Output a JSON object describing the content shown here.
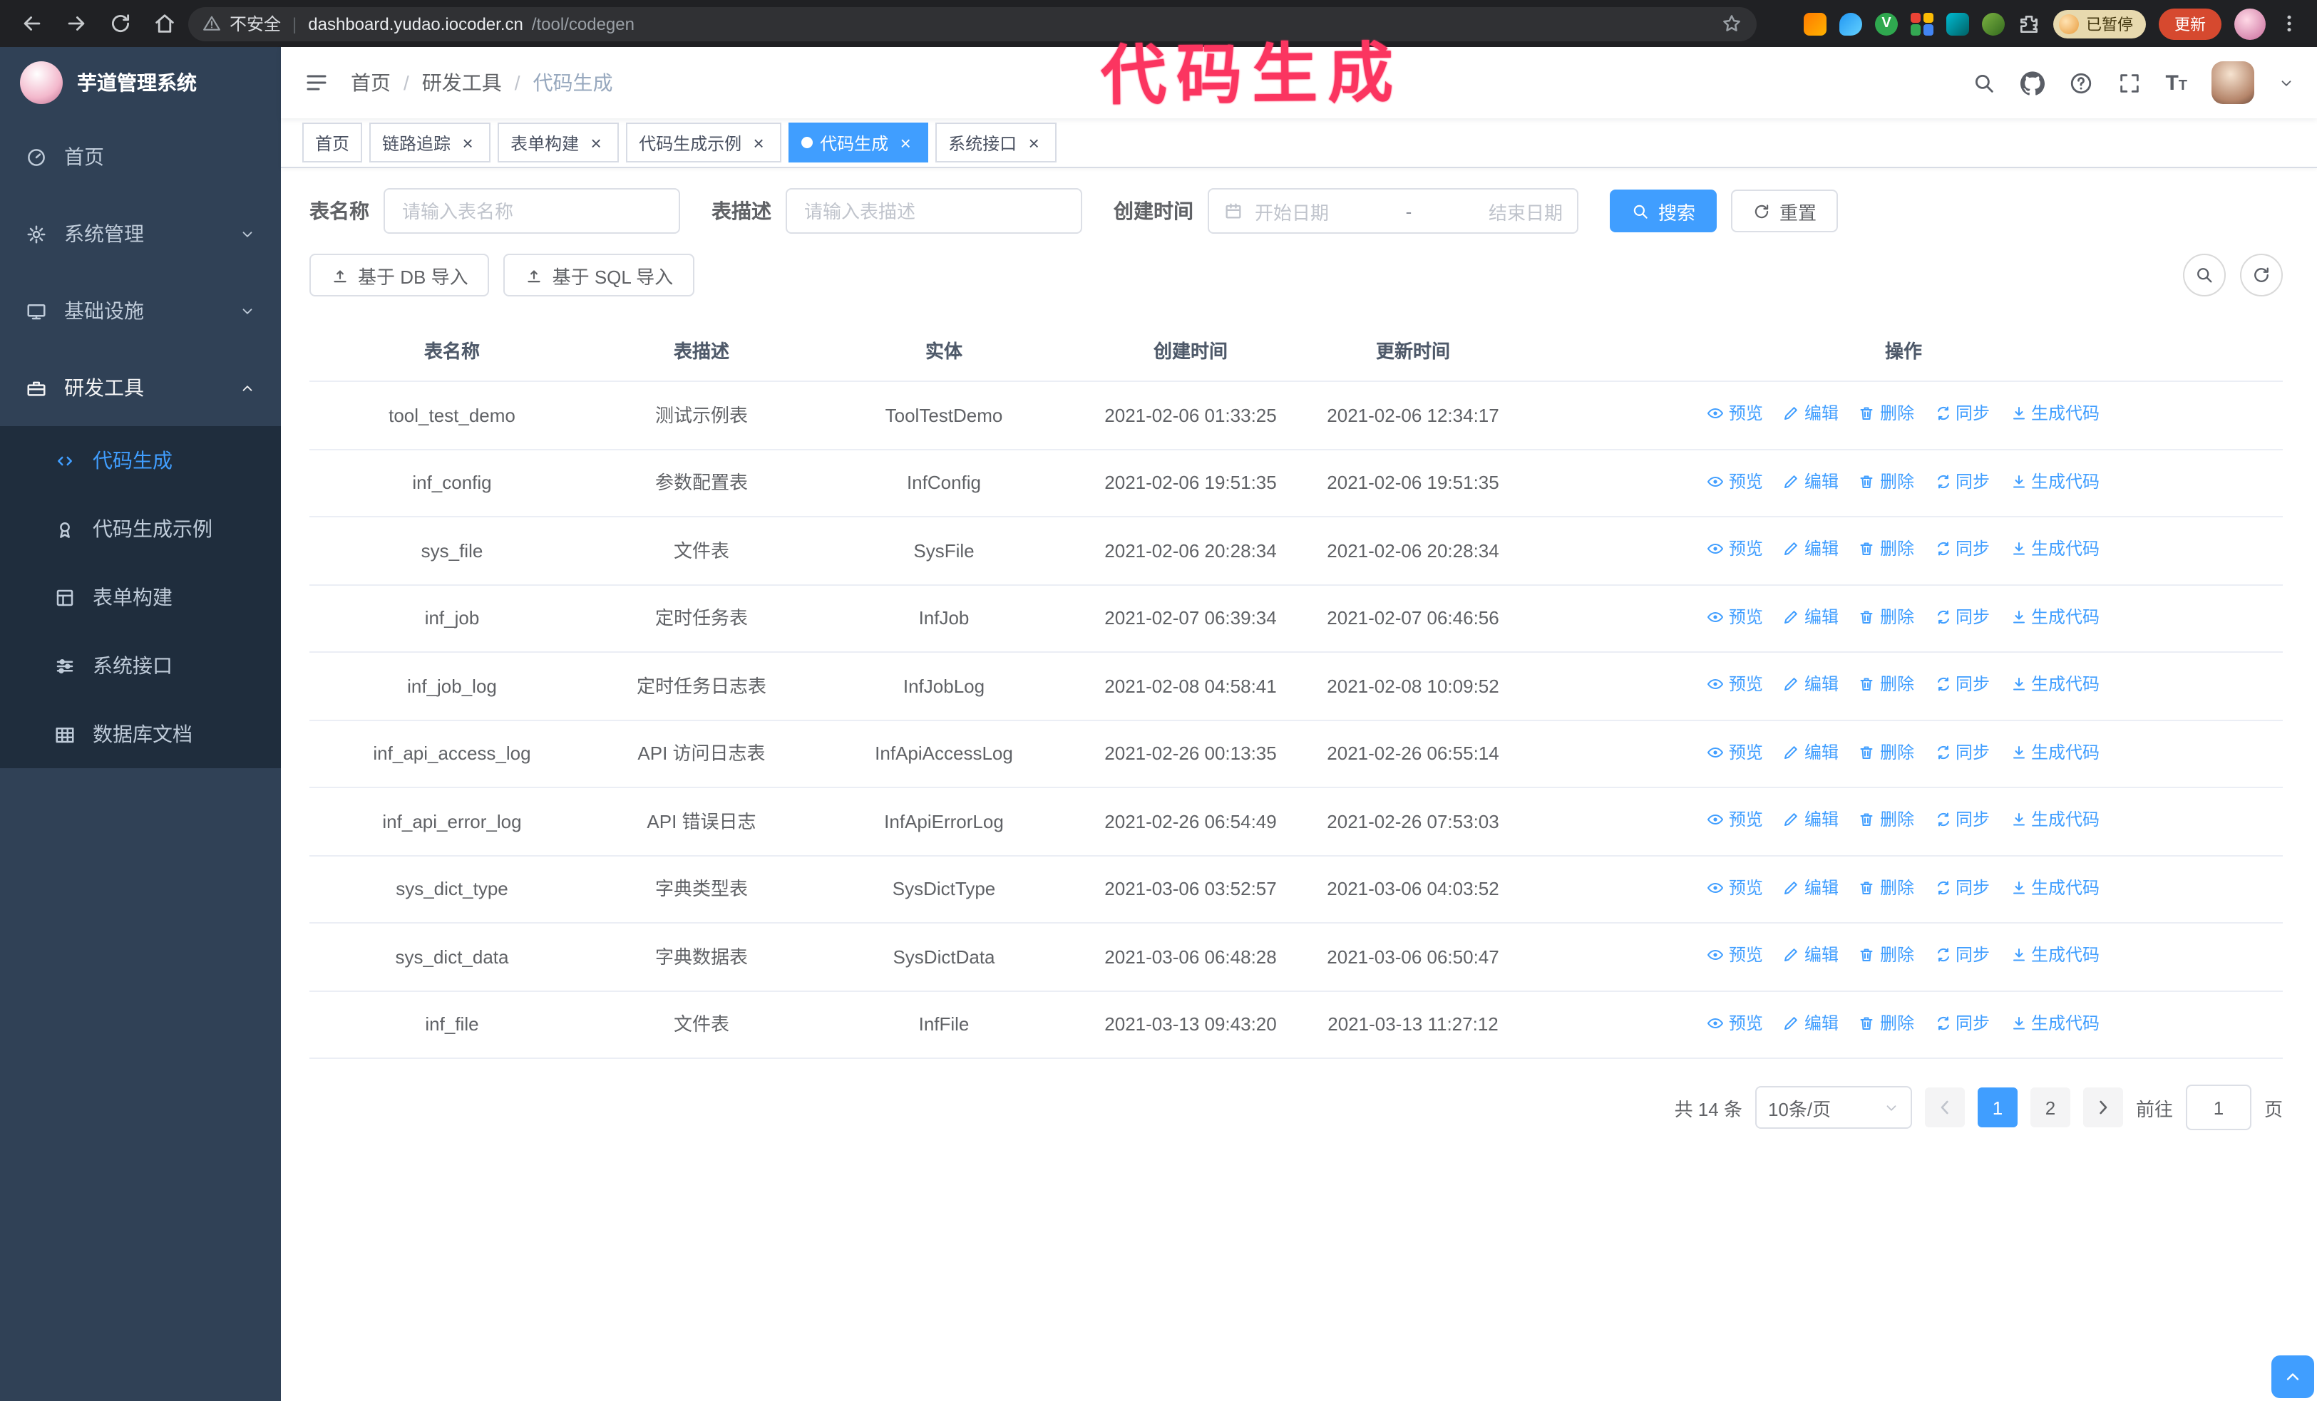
{
  "browser": {
    "security_label": "不安全",
    "url_domain": "dashboard.yudao.iocoder.cn",
    "url_path": "/tool/codegen",
    "separator": "|",
    "paused_badge": "已暂停",
    "update_button": "更新"
  },
  "annotation": {
    "text": "代码生成",
    "color": "#fb3560"
  },
  "sidebar": {
    "logo_title": "芋道管理系统",
    "menu": [
      {
        "label": "首页",
        "icon": "gauge-icon"
      },
      {
        "label": "系统管理",
        "icon": "gear-icon",
        "expandable": true
      },
      {
        "label": "基础设施",
        "icon": "infra-icon",
        "expandable": true
      },
      {
        "label": "研发工具",
        "icon": "tools-icon",
        "expandable": true,
        "expanded": true,
        "children": [
          {
            "label": "代码生成",
            "icon": "code-icon",
            "active": true
          },
          {
            "label": "代码生成示例",
            "icon": "medal-icon"
          },
          {
            "label": "表单构建",
            "icon": "form-icon"
          },
          {
            "label": "系统接口",
            "icon": "api-icon"
          },
          {
            "label": "数据库文档",
            "icon": "dbdoc-icon"
          }
        ]
      }
    ]
  },
  "header": {
    "breadcrumb": [
      {
        "label": "首页"
      },
      {
        "label": "研发工具"
      },
      {
        "label": "代码生成"
      }
    ],
    "separator": "/"
  },
  "tabs": [
    {
      "label": "首页",
      "closable": false,
      "active": false
    },
    {
      "label": "链路追踪",
      "closable": true,
      "active": false
    },
    {
      "label": "表单构建",
      "closable": true,
      "active": false
    },
    {
      "label": "代码生成示例",
      "closable": true,
      "active": false
    },
    {
      "label": "代码生成",
      "closable": true,
      "active": true
    },
    {
      "label": "系统接口",
      "closable": true,
      "active": false
    }
  ],
  "filters": {
    "table_name_label": "表名称",
    "table_name_placeholder": "请输入表名称",
    "table_desc_label": "表描述",
    "table_desc_placeholder": "请输入表描述",
    "create_time_label": "创建时间",
    "start_date_placeholder": "开始日期",
    "range_separator": "-",
    "end_date_placeholder": "结束日期",
    "search_button": "搜索",
    "reset_button": "重置"
  },
  "toolbar": {
    "db_import_button": "基于 DB 导入",
    "sql_import_button": "基于 SQL 导入"
  },
  "table": {
    "columns": [
      "表名称",
      "表描述",
      "实体",
      "创建时间",
      "更新时间",
      "操作"
    ],
    "row_actions": [
      {
        "label": "预览",
        "icon": "eye-icon",
        "name": "preview-action"
      },
      {
        "label": "编辑",
        "icon": "pencil-icon",
        "name": "edit-action"
      },
      {
        "label": "删除",
        "icon": "trash-icon",
        "name": "delete-action"
      },
      {
        "label": "同步",
        "icon": "sync-icon",
        "name": "sync-action"
      },
      {
        "label": "生成代码",
        "icon": "download-icon",
        "name": "generate-code-action"
      }
    ],
    "rows": [
      {
        "name": "tool_test_demo",
        "desc": "测试示例表",
        "entity": "ToolTestDemo",
        "created": "2021-02-06 01:33:25",
        "updated": "2021-02-06 12:34:17"
      },
      {
        "name": "inf_config",
        "desc": "参数配置表",
        "entity": "InfConfig",
        "created": "2021-02-06 19:51:35",
        "updated": "2021-02-06 19:51:35"
      },
      {
        "name": "sys_file",
        "desc": "文件表",
        "entity": "SysFile",
        "created": "2021-02-06 20:28:34",
        "updated": "2021-02-06 20:28:34"
      },
      {
        "name": "inf_job",
        "desc": "定时任务表",
        "entity": "InfJob",
        "created": "2021-02-07 06:39:34",
        "updated": "2021-02-07 06:46:56"
      },
      {
        "name": "inf_job_log",
        "desc": "定时任务日志表",
        "entity": "InfJobLog",
        "created": "2021-02-08 04:58:41",
        "updated": "2021-02-08 10:09:52"
      },
      {
        "name": "inf_api_access_log",
        "desc": "API 访问日志表",
        "entity": "InfApiAccessLog",
        "created": "2021-02-26 00:13:35",
        "updated": "2021-02-26 06:55:14"
      },
      {
        "name": "inf_api_error_log",
        "desc": "API 错误日志",
        "entity": "InfApiErrorLog",
        "created": "2021-02-26 06:54:49",
        "updated": "2021-02-26 07:53:03"
      },
      {
        "name": "sys_dict_type",
        "desc": "字典类型表",
        "entity": "SysDictType",
        "created": "2021-03-06 03:52:57",
        "updated": "2021-03-06 04:03:52"
      },
      {
        "name": "sys_dict_data",
        "desc": "字典数据表",
        "entity": "SysDictData",
        "created": "2021-03-06 06:48:28",
        "updated": "2021-03-06 06:50:47"
      },
      {
        "name": "inf_file",
        "desc": "文件表",
        "entity": "InfFile",
        "created": "2021-03-13 09:43:20",
        "updated": "2021-03-13 11:27:12"
      }
    ]
  },
  "pagination": {
    "total_text": "共 14 条",
    "page_size": "10条/页",
    "pages": [
      {
        "label": "1",
        "active": true
      },
      {
        "label": "2",
        "active": false
      }
    ],
    "goto_prefix": "前往",
    "goto_value": "1",
    "goto_suffix": "页"
  },
  "colors": {
    "accent": "#409EFF",
    "sidebar_bg": "#304156",
    "submenu_bg": "#1f2d3d",
    "annotation": "#fb3560",
    "update_button_bg": "#d6492f",
    "row_divider": "#ebeef5"
  }
}
